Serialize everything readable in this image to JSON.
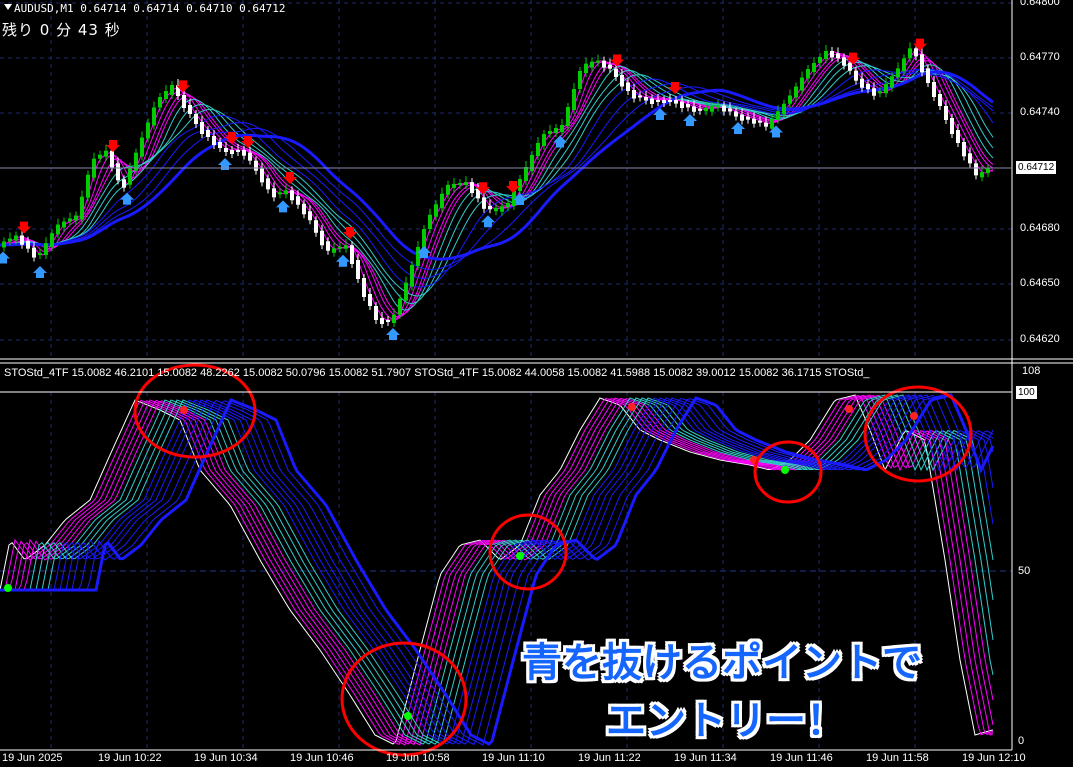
{
  "header": {
    "symbol_line": "AUDUSD,M1  0.64714 0.64714 0.64710 0.64712",
    "countdown": "残り 0 分 43 秒"
  },
  "price_axis": {
    "labels": [
      "0.64800",
      "0.64770",
      "0.64740",
      "0.64710",
      "0.64680",
      "0.64650",
      "0.64620"
    ],
    "current_price": "0.64712"
  },
  "indicator": {
    "header_text": "STOStd_4TF 15.0082 46.2101 15.0082 48.2262 15.0082 50.0796 15.0082 51.7907  STOStd_4TF 15.0082 44.0058 15.0082 41.5988 15.0082 39.0012 15.0082 36.1715  STOStd_",
    "scale_max": "108",
    "level_100": "100",
    "level_50": "50",
    "level_0": "0"
  },
  "time_axis": {
    "labels": [
      "19 Jun 2025",
      "19 Jun 10:22",
      "19 Jun 10:34",
      "19 Jun 10:46",
      "19 Jun 10:58",
      "19 Jun 11:10",
      "19 Jun 11:22",
      "19 Jun 11:34",
      "19 Jun 11:46",
      "19 Jun 11:58",
      "19 Jun 12:10"
    ]
  },
  "annotation": {
    "line1": "青を抜けるポイントで",
    "line2": "エントリー！"
  },
  "colors": {
    "background": "#000000",
    "bull_candle": "#00cc00",
    "bear_candle": "#ffffff",
    "grid": "#1c2a6e",
    "ribbon_fast": "#ff00ff",
    "ribbon_mid": "#33cccc",
    "ribbon_slow": "#1a1aff",
    "sell_arrow": "#ff0000",
    "buy_arrow": "#3399ff",
    "circle": "#ff0000",
    "annotation_text": "#1565ff"
  }
}
